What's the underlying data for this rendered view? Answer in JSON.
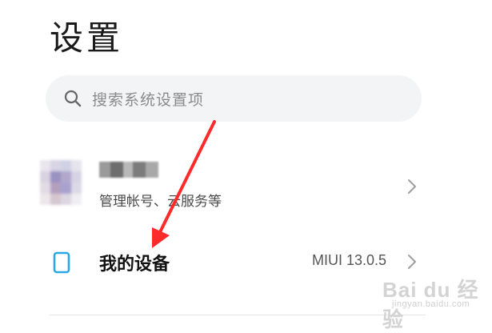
{
  "page": {
    "title": "设置"
  },
  "search": {
    "placeholder": "搜索系统设置项"
  },
  "account": {
    "name_obscured": "",
    "subtitle": "管理帐号、云服务等",
    "icon": "chevron-right-icon"
  },
  "device": {
    "label": "我的设备",
    "value": "MIUI 13.0.5",
    "icon": "phone-icon",
    "chevron": "chevron-right-icon"
  },
  "annotation": {
    "arrow_color": "#ff2a2a"
  },
  "watermark": {
    "logo": "Bai du 经验",
    "url": "jingyan.baidu.com"
  },
  "colors": {
    "background": "#ffffff",
    "search_bg": "#f3f4f6",
    "device_icon": "#2aa8e6",
    "chevron": "#b0b0b0"
  }
}
